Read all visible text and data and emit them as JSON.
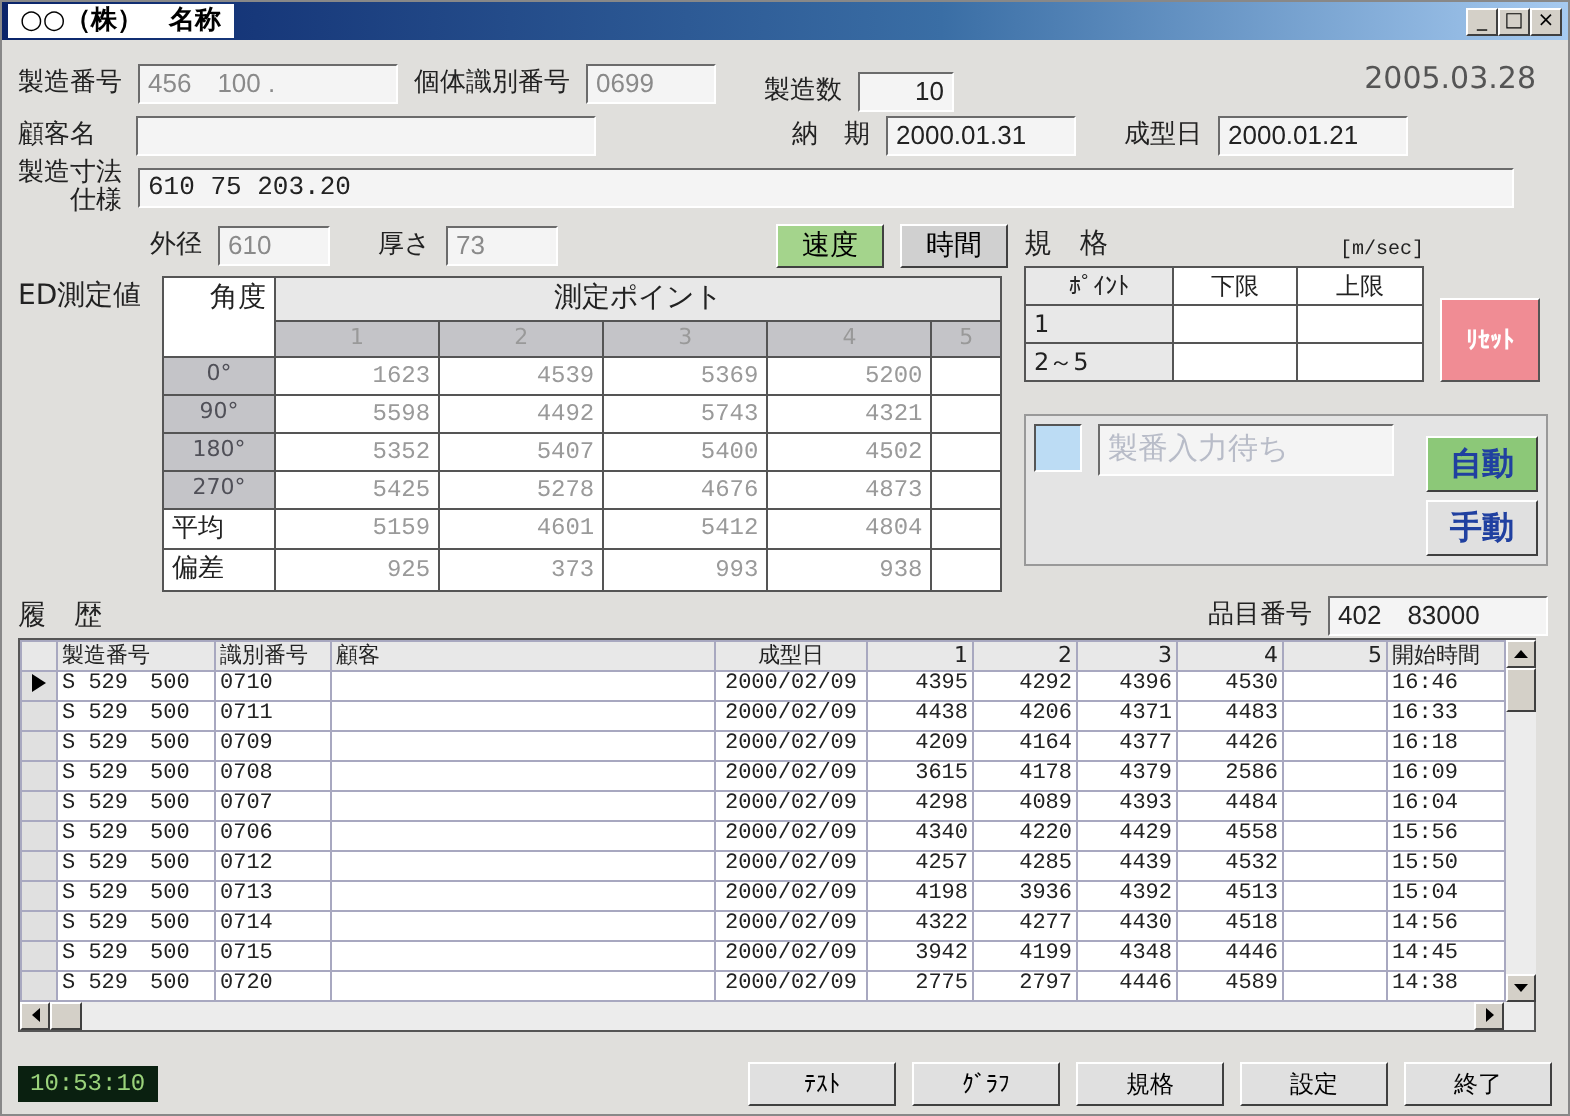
{
  "window": {
    "title": "○○（株）　名称",
    "controls": [
      "_",
      "□",
      "×"
    ]
  },
  "date": "2005.03.28",
  "fields": {
    "serial": {
      "label": "製造番号",
      "value": "456　100 ."
    },
    "unit_id": {
      "label": "個体識別番号",
      "value": "0699"
    },
    "quantity": {
      "label": "製造数",
      "value": "10"
    },
    "customer": {
      "label": "顧客名"
    },
    "due": {
      "label": "納　期",
      "value": "2000.01.31"
    },
    "molded": {
      "label": "成型日",
      "value": "2000.01.21"
    },
    "spec": {
      "label": [
        "製造寸法",
        "仕様"
      ],
      "value": "610 75 203.20"
    },
    "outer": {
      "label": "外径",
      "value": "610"
    },
    "thickness": {
      "label": "厚さ",
      "value": "73"
    }
  },
  "mode_buttons": [
    {
      "label": "速度",
      "selected": true
    },
    {
      "label": "時間",
      "selected": false
    }
  ],
  "measurement": {
    "label": "ED測定値",
    "corner": "角度",
    "group": "測定ポイント",
    "points": [
      "1",
      "2",
      "3",
      "4",
      "5"
    ],
    "rows": [
      {
        "kind": "angle",
        "label": "0°",
        "values": [
          "1623",
          "4539",
          "5369",
          "5200"
        ]
      },
      {
        "kind": "angle",
        "label": "90°",
        "values": [
          "5598",
          "4492",
          "5743",
          "4321"
        ]
      },
      {
        "kind": "angle",
        "label": "180°",
        "values": [
          "5352",
          "5407",
          "5400",
          "4502"
        ]
      },
      {
        "kind": "angle",
        "label": "270°",
        "values": [
          "5425",
          "5278",
          "4676",
          "4873"
        ]
      },
      {
        "kind": "stat",
        "label": "平均",
        "values": [
          "5159",
          "4601",
          "5412",
          "4804"
        ]
      },
      {
        "kind": "stat",
        "label": "偏差",
        "values": [
          "925",
          "373",
          "993",
          "938"
        ]
      }
    ]
  },
  "standard": {
    "title": "規　格",
    "unit": "[m/sec]",
    "columns": [
      "ﾎﾟｲﾝﾄ",
      "下限",
      "上限"
    ],
    "rows": [
      "1",
      "2～5"
    ]
  },
  "reset_button": "ﾘｾｯﾄ",
  "status": {
    "message": "製番入力待ち"
  },
  "run_mode": [
    {
      "label": "自動",
      "selected": true
    },
    {
      "label": "手動",
      "selected": false
    }
  ],
  "item_number": {
    "label": "品目番号",
    "value": "402　83000"
  },
  "history": {
    "label": "履　歴",
    "columns": [
      "製造番号",
      "識別番号",
      "顧客",
      "成型日",
      "1",
      "2",
      "3",
      "4",
      "5",
      "開始時間"
    ],
    "rows": [
      {
        "selected": true,
        "serial": "S 529　500",
        "id": "0710",
        "date": "2000/02/09",
        "values": [
          "4395",
          "4292",
          "4396",
          "4530"
        ],
        "time": "16:46"
      },
      {
        "selected": false,
        "serial": "S 529　500",
        "id": "0711",
        "date": "2000/02/09",
        "values": [
          "4438",
          "4206",
          "4371",
          "4483"
        ],
        "time": "16:33"
      },
      {
        "selected": false,
        "serial": "S 529　500",
        "id": "0709",
        "date": "2000/02/09",
        "values": [
          "4209",
          "4164",
          "4377",
          "4426"
        ],
        "time": "16:18"
      },
      {
        "selected": false,
        "serial": "S 529　500",
        "id": "0708",
        "date": "2000/02/09",
        "values": [
          "3615",
          "4178",
          "4379",
          "2586"
        ],
        "time": "16:09"
      },
      {
        "selected": false,
        "serial": "S 529　500",
        "id": "0707",
        "date": "2000/02/09",
        "values": [
          "4298",
          "4089",
          "4393",
          "4484"
        ],
        "time": "16:04"
      },
      {
        "selected": false,
        "serial": "S 529　500",
        "id": "0706",
        "date": "2000/02/09",
        "values": [
          "4340",
          "4220",
          "4429",
          "4558"
        ],
        "time": "15:56"
      },
      {
        "selected": false,
        "serial": "S 529　500",
        "id": "0712",
        "date": "2000/02/09",
        "values": [
          "4257",
          "4285",
          "4439",
          "4532"
        ],
        "time": "15:50"
      },
      {
        "selected": false,
        "serial": "S 529　500",
        "id": "0713",
        "date": "2000/02/09",
        "values": [
          "4198",
          "3936",
          "4392",
          "4513"
        ],
        "time": "15:04"
      },
      {
        "selected": false,
        "serial": "S 529　500",
        "id": "0714",
        "date": "2000/02/09",
        "values": [
          "4322",
          "4277",
          "4430",
          "4518"
        ],
        "time": "14:56"
      },
      {
        "selected": false,
        "serial": "S 529　500",
        "id": "0715",
        "date": "2000/02/09",
        "values": [
          "3942",
          "4199",
          "4348",
          "4446"
        ],
        "time": "14:45"
      },
      {
        "selected": false,
        "serial": "S 529　500",
        "id": "0720",
        "date": "2000/02/09",
        "values": [
          "2775",
          "2797",
          "4446",
          "4589"
        ],
        "time": "14:38"
      }
    ]
  },
  "clock": "10:53:10",
  "bottom_buttons": [
    "ﾃｽﾄ",
    "ｸﾞﾗﾌ",
    "規格",
    "設定",
    "終了"
  ]
}
